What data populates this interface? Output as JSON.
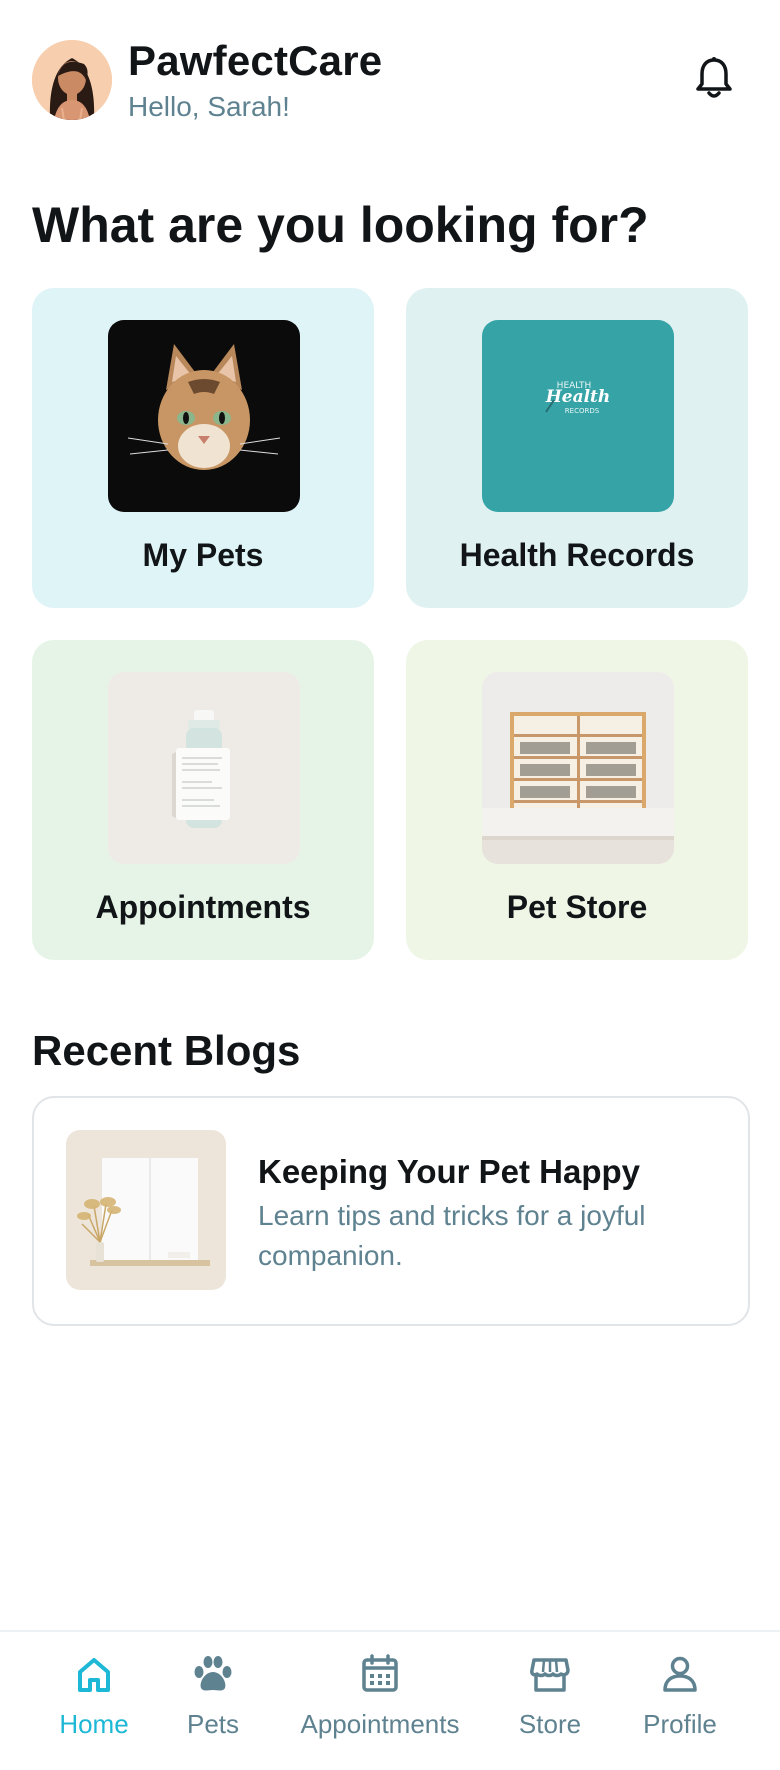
{
  "header": {
    "app_title": "PawfectCare",
    "greeting": "Hello, Sarah!"
  },
  "main": {
    "section_title": "What are you looking for?",
    "categories": [
      {
        "label": "My Pets",
        "icon": "cat-photo"
      },
      {
        "label": "Health Records",
        "icon": "health-records-logo",
        "thumb_text": [
          "HEALTH",
          "Health",
          "RECORDS"
        ]
      },
      {
        "label": "Appointments",
        "icon": "medicine-bottle-photo"
      },
      {
        "label": "Pet Store",
        "icon": "store-shelves-photo"
      }
    ]
  },
  "blogs": {
    "section_title": "Recent Blogs",
    "items": [
      {
        "title": "Keeping Your Pet Happy",
        "description": "Learn tips and tricks for a joyful companion."
      }
    ]
  },
  "bottom_nav": {
    "items": [
      {
        "label": "Home",
        "icon": "home-icon",
        "active": true
      },
      {
        "label": "Pets",
        "icon": "paw-icon",
        "active": false
      },
      {
        "label": "Appointments",
        "icon": "calendar-icon",
        "active": false
      },
      {
        "label": "Store",
        "icon": "store-icon",
        "active": false
      },
      {
        "label": "Profile",
        "icon": "person-icon",
        "active": false
      }
    ]
  },
  "colors": {
    "accent": "#1cb8d6",
    "muted_text": "#5f8290",
    "primary_text": "#111518",
    "card_pets_bg": "#dff4f7",
    "card_health_bg": "#dff1f0",
    "card_appointments_bg": "#e6f4e7",
    "card_store_bg": "#eff6e6"
  }
}
